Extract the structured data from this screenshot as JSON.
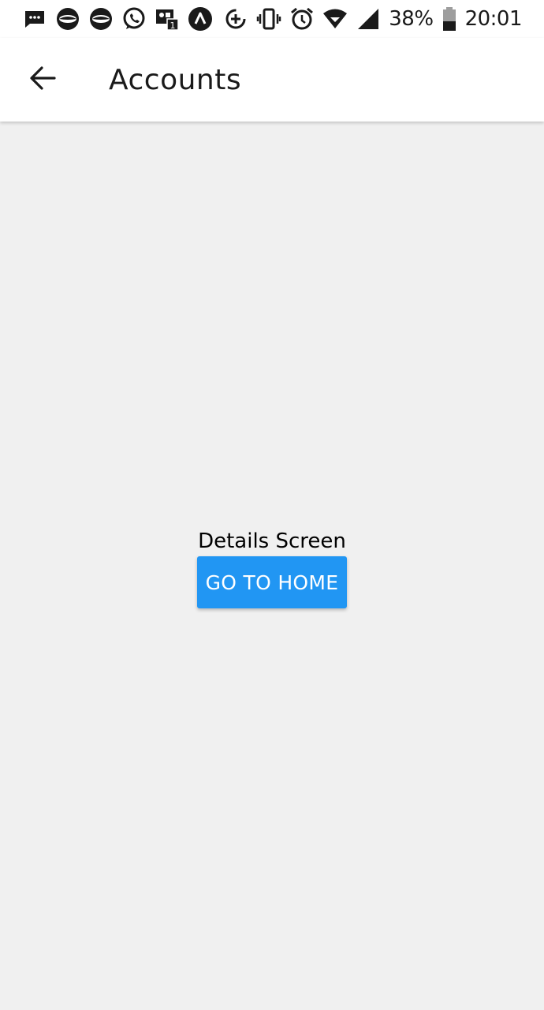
{
  "status_bar": {
    "left_icons": [
      "message-icon",
      "lips-icon",
      "lips-icon",
      "whatsapp-icon",
      "voicemail-icon",
      "expo-icon"
    ],
    "right_icons": [
      "data-saver-icon",
      "vibrate-icon",
      "alarm-icon",
      "wifi-icon",
      "cell-signal-icon",
      "battery-icon"
    ],
    "battery_percent": "38%",
    "time": "20:01"
  },
  "app_bar": {
    "back_icon": "arrow-left-icon",
    "title": "Accounts"
  },
  "content": {
    "heading": "Details Screen",
    "button_label": "GO TO HOME"
  },
  "colors": {
    "app_bar_bg": "#ffffff",
    "content_bg": "#f0f0f0",
    "button_bg": "#2196f3",
    "button_text": "#ffffff"
  }
}
